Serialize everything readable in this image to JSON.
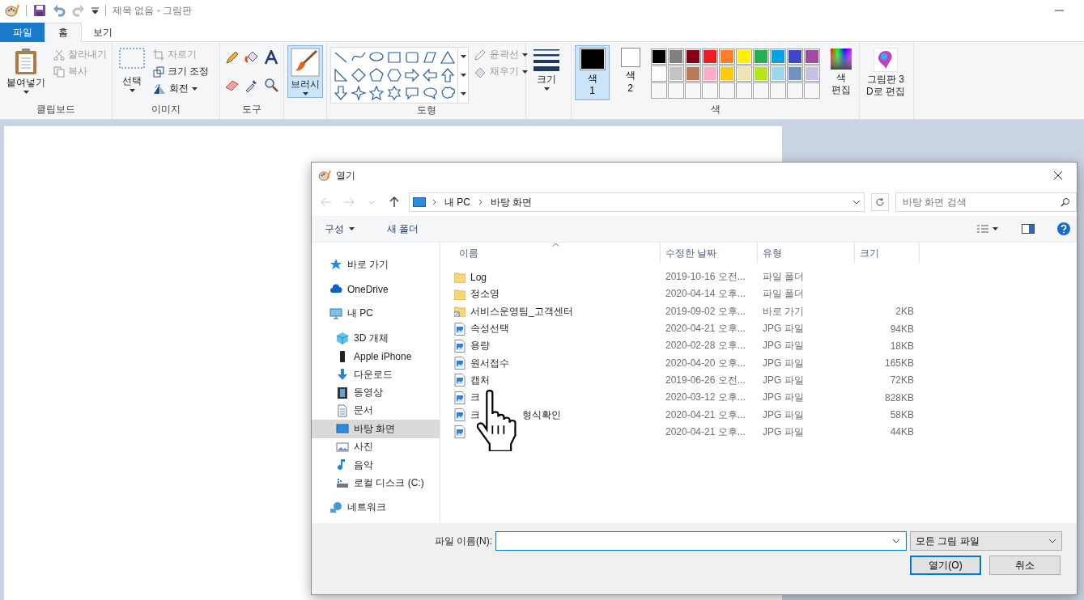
{
  "app": {
    "title": "제목 없음 - 그림판"
  },
  "ribbon_tabs": [
    {
      "label": "파일",
      "kind": "file",
      "selected": false
    },
    {
      "label": "홈",
      "kind": "tab",
      "selected": true
    },
    {
      "label": "보기",
      "kind": "tab",
      "selected": false
    }
  ],
  "clipboard": {
    "label": "클립보드",
    "paste": "붙여넣기",
    "cut": {
      "label": "잘라내기",
      "disabled": true
    },
    "copy": {
      "label": "복사",
      "disabled": true
    }
  },
  "image": {
    "label": "이미지",
    "select": "선택",
    "crop": {
      "label": "자르기",
      "disabled": true
    },
    "resize": {
      "label": "크기 조정",
      "disabled": false
    },
    "rotate": {
      "label": "회전",
      "disabled": false
    }
  },
  "tools": {
    "label": "도구"
  },
  "brushes": {
    "label": "브러시",
    "selected": true
  },
  "shapes": {
    "label": "도형",
    "outline": {
      "label": "윤곽선",
      "disabled": true
    },
    "fill": {
      "label": "채우기",
      "disabled": true
    }
  },
  "size": {
    "label": "크기"
  },
  "colors": {
    "label": "색",
    "edit_lines": [
      "색",
      "편집"
    ],
    "slots": [
      {
        "lines": [
          "색",
          "1"
        ],
        "color": "#000000",
        "selected": true
      },
      {
        "lines": [
          "색",
          "2"
        ],
        "color": "#ffffff",
        "selected": false
      }
    ],
    "palette": [
      {
        "color": "#000000"
      },
      {
        "color": "#7f7f7f"
      },
      {
        "color": "#880015"
      },
      {
        "color": "#ed1c24"
      },
      {
        "color": "#ff7f27"
      },
      {
        "color": "#fff200"
      },
      {
        "color": "#22b14c"
      },
      {
        "color": "#00a2e8"
      },
      {
        "color": "#3f48cc"
      },
      {
        "color": "#a349a4"
      },
      {
        "color": "#ffffff"
      },
      {
        "color": "#c3c3c3"
      },
      {
        "color": "#b97a57"
      },
      {
        "color": "#ffaec9"
      },
      {
        "color": "#ffc90e"
      },
      {
        "color": "#efe4b0"
      },
      {
        "color": "#b5e61d"
      },
      {
        "color": "#99d9ea"
      },
      {
        "color": "#7092be"
      },
      {
        "color": "#c8bfe7"
      }
    ]
  },
  "paint3d": {
    "lines": [
      "그림판 3",
      "D로 편집"
    ]
  },
  "dialog": {
    "title": "열기",
    "breadcrumb": [
      "내 PC",
      "바탕 화면"
    ],
    "search": {
      "placeholder": "바탕 화면 검색"
    },
    "toolbar": {
      "organize": "구성",
      "new_folder": "새 폴더"
    },
    "nav": [
      {
        "label": "바로 가기",
        "kind": "star",
        "selected": false
      },
      {
        "label": "OneDrive",
        "kind": "cloud",
        "selected": false
      },
      {
        "label": "내 PC",
        "kind": "pc",
        "selected": false,
        "children": [
          {
            "label": "3D 개체",
            "kind": "cube",
            "selected": false
          },
          {
            "label": "Apple iPhone",
            "kind": "phone",
            "selected": false
          },
          {
            "label": "다운로드",
            "kind": "download",
            "selected": false
          },
          {
            "label": "동영상",
            "kind": "film",
            "selected": false
          },
          {
            "label": "문서",
            "kind": "document",
            "selected": false
          },
          {
            "label": "바탕 화면",
            "kind": "desktop",
            "selected": true
          },
          {
            "label": "사진",
            "kind": "picture",
            "selected": false
          },
          {
            "label": "음악",
            "kind": "music",
            "selected": false
          },
          {
            "label": "로컬 디스크 (C:)",
            "kind": "disk",
            "selected": false
          }
        ]
      },
      {
        "label": "네트워크",
        "kind": "network",
        "selected": false
      }
    ],
    "columns": [
      "이름",
      "수정한 날짜",
      "유형",
      "크기"
    ],
    "files": [
      {
        "kind": "folder",
        "name_parts": [
          "Log"
        ],
        "date": "2019-10-16 오전...",
        "type": "파일 폴더"
      },
      {
        "kind": "folder",
        "name_parts": [
          "정소영"
        ],
        "date": "2020-04-14 오후...",
        "type": "파일 폴더"
      },
      {
        "kind": "shortcut",
        "name_parts": [
          "서비스운영팀_고객센터"
        ],
        "date": "2019-09-02 오후...",
        "type": "바로 가기",
        "size": "2KB"
      },
      {
        "kind": "image",
        "name_parts": [
          "속성선택"
        ],
        "date": "2020-04-21 오후...",
        "type": "JPG 파일",
        "size": "94KB"
      },
      {
        "kind": "image",
        "name_parts": [
          "용량"
        ],
        "date": "2020-02-28 오후...",
        "type": "JPG 파일",
        "size": "18KB"
      },
      {
        "kind": "image",
        "name_parts": [
          "원서접수"
        ],
        "date": "2020-04-20 오후...",
        "type": "JPG 파일",
        "size": "165KB"
      },
      {
        "kind": "image",
        "name_parts": [
          "캡처"
        ],
        "date": "2019-06-26 오전...",
        "type": "JPG 파일",
        "size": "72KB"
      },
      {
        "kind": "image",
        "name_parts": [
          "크"
        ],
        "date": "2020-03-12 오후...",
        "type": "JPG 파일",
        "size": "828KB"
      },
      {
        "kind": "image",
        "name_parts": [
          "크",
          "형식확인"
        ],
        "date": "2020-04-21 오후...",
        "type": "JPG 파일",
        "size": "58KB"
      },
      {
        "kind": "image",
        "date": "2020-04-21 오후...",
        "type": "JPG 파일",
        "size": "44KB"
      }
    ],
    "filename_label": "파일 이름(N):",
    "filter": "모든 그림 파일",
    "buttons": [
      {
        "label": "열기(O)",
        "kind": "default"
      },
      {
        "label": "취소",
        "kind": "normal"
      }
    ]
  }
}
